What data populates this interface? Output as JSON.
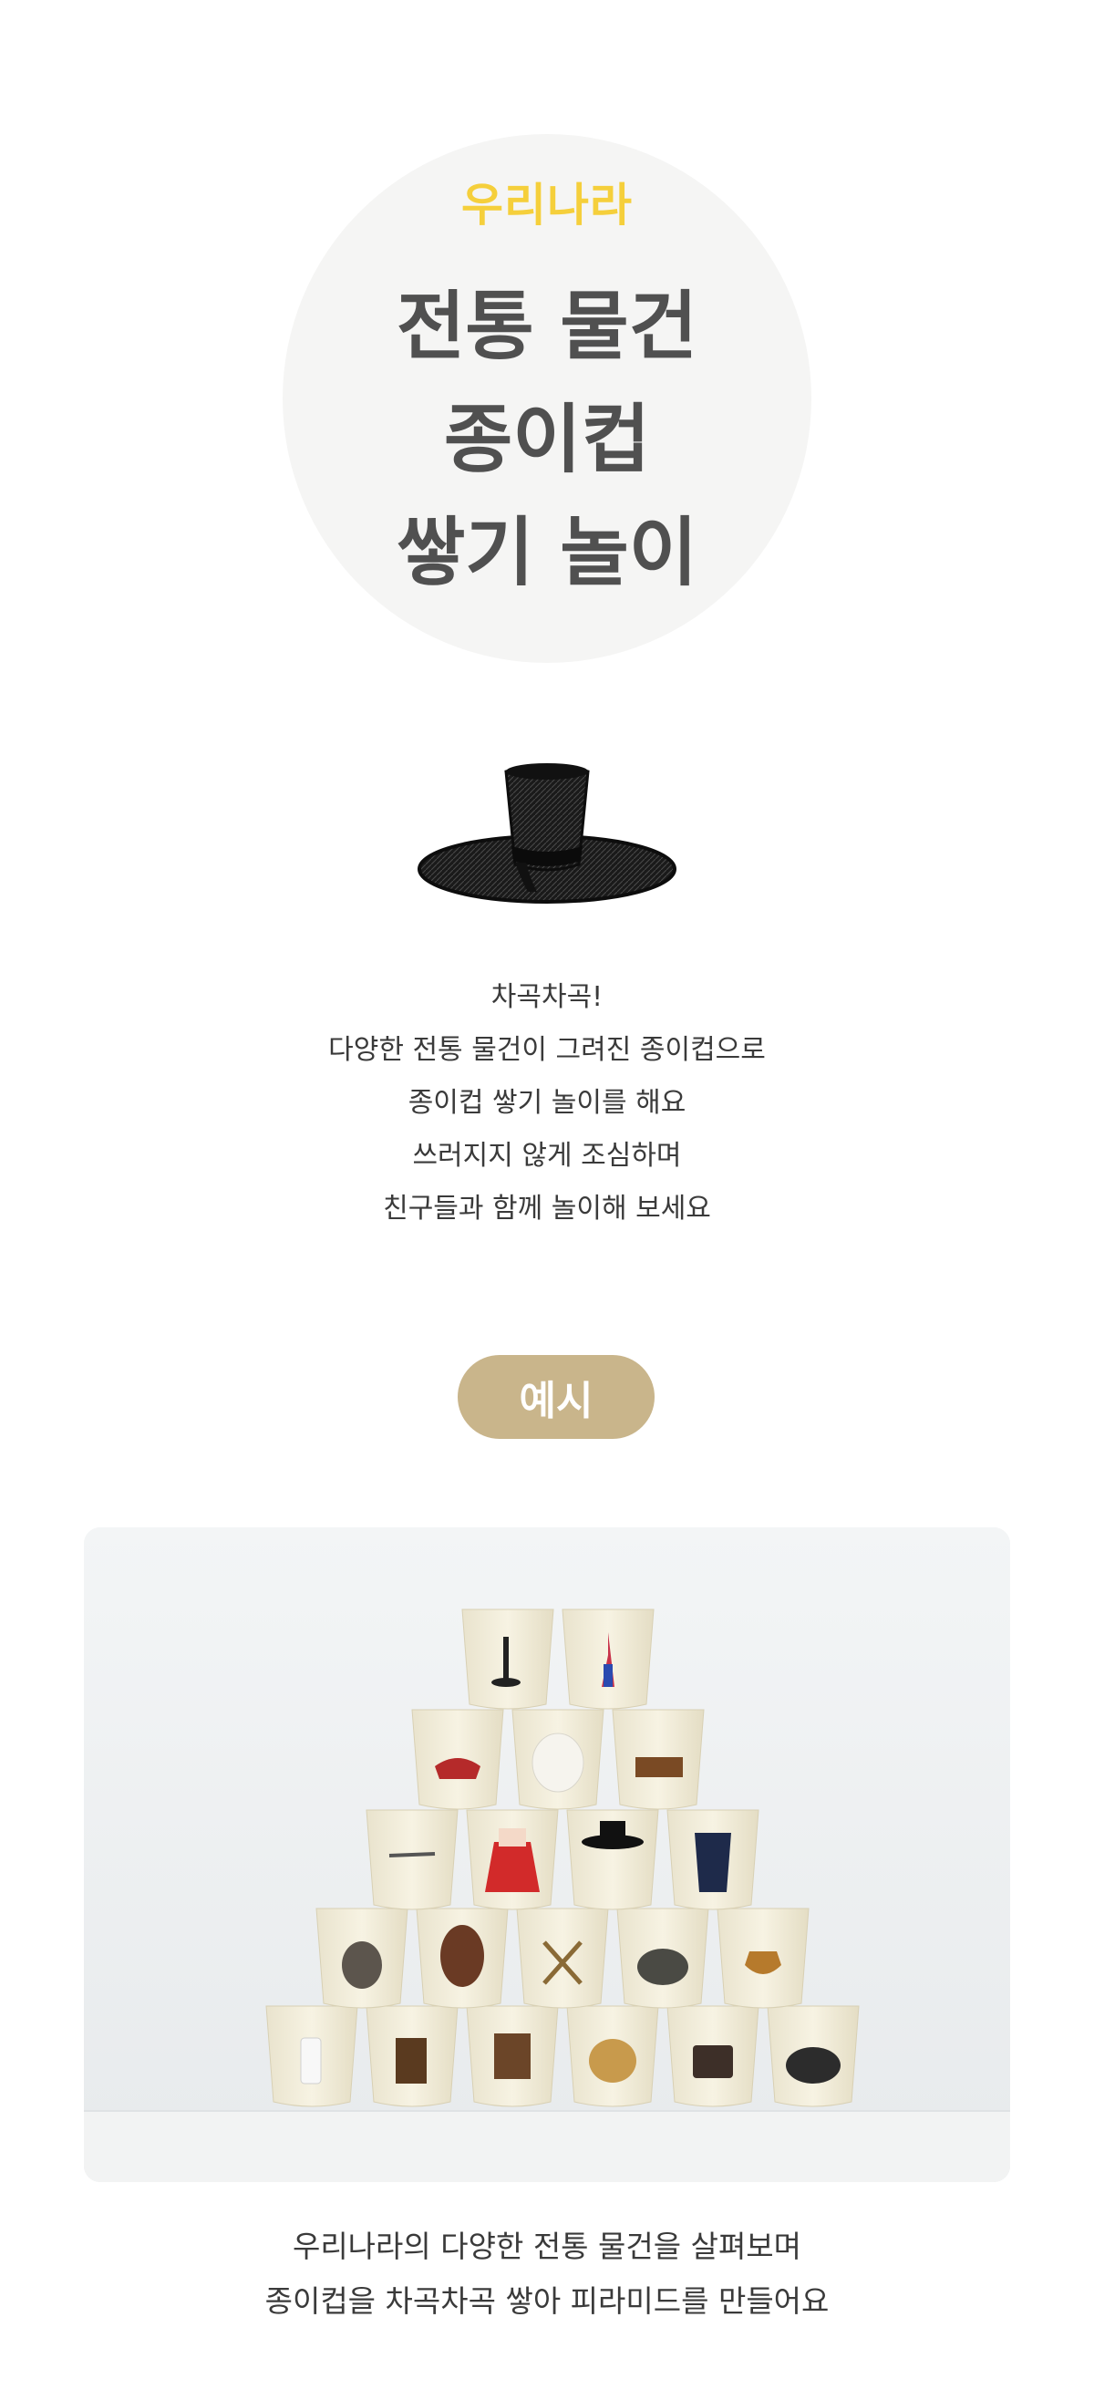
{
  "hero": {
    "subtitle": "우리나라",
    "title_lines": [
      "전통 물건",
      "종이컵",
      "쌓기 놀이"
    ]
  },
  "hat_image": {
    "icon": "gat-hat-icon"
  },
  "description": {
    "lines": [
      "차곡차곡!",
      "다양한 전통 물건이 그려진 종이컵으로",
      "종이컵 쌓기 놀이를 해요",
      "쓰러지지 않게 조심하며",
      "친구들과 함께 놀이해 보세요"
    ]
  },
  "example_badge": {
    "label": "예시",
    "color": "#c9b58b"
  },
  "photo": {
    "icons": [
      "traditional-lamp-icon",
      "norigae-tassel-icon",
      "embroidered-shoes-icon",
      "moon-jar-icon",
      "wooden-box-icon",
      "pipe-icon",
      "hanbok-red-icon",
      "gat-hat-icon",
      "hanbok-blue-icon",
      "mortar-icon",
      "mask-icon",
      "jige-frame-icon",
      "sieve-icon",
      "wooden-shoes-icon",
      "beoseon-socks-icon",
      "wooden-cabinet-icon",
      "palanquin-icon",
      "straw-hat-icon",
      "chest-icon",
      "iron-pot-icon"
    ]
  },
  "caption": {
    "lines": [
      "우리나라의 다양한 전통 물건을 살펴보며",
      "종이컵을 차곡차곡 쌓아 피라미드를 만들어요"
    ]
  },
  "colors": {
    "accent_yellow": "#f5cf3b",
    "title_gray": "#505050",
    "circle_bg": "#f5f5f4"
  }
}
